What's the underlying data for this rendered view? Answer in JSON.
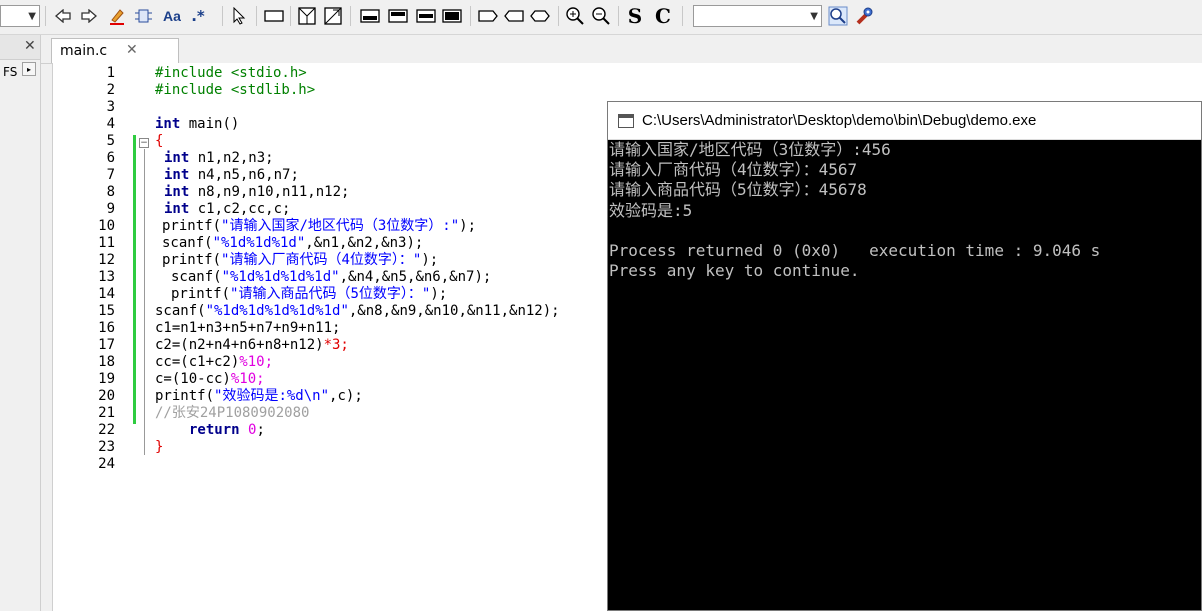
{
  "toolbar": {
    "text_buttons": {
      "font_icon_label": "Aa",
      "regex_label": ".*",
      "s_label": "S",
      "c_label": "C"
    }
  },
  "left_panel": {
    "label": "FS",
    "close_glyph": "✕",
    "arrow_glyph": "▸"
  },
  "tab": {
    "label": "main.c",
    "close_glyph": "✕"
  },
  "line_numbers": [
    "1",
    "2",
    "3",
    "4",
    "5",
    "6",
    "7",
    "8",
    "9",
    "10",
    "11",
    "12",
    "13",
    "14",
    "15",
    "16",
    "17",
    "18",
    "19",
    "20",
    "21",
    "22",
    "23",
    "24"
  ],
  "code": {
    "l1": "#include <stdio.h>",
    "l2": "#include <stdlib.h>",
    "l4_kw": "int",
    "l4_rest": " main()",
    "l5": "{",
    "l6_kw": "int",
    "l6_rest": " n1,n2,n3;",
    "l7_kw": "int",
    "l7_rest": " n4,n5,n6,n7;",
    "l8_kw": "int",
    "l8_rest": " n8,n9,n10,n11,n12;",
    "l9_kw": "int",
    "l9_rest": " c1,c2,cc,c;",
    "l10_fn": "printf(",
    "l10_str": "\"请输入国家/地区代码（3位数字）:\"",
    "l10_end": ");",
    "l11_fn": "scanf(",
    "l11_str": "\"%1d%1d%1d\"",
    "l11_end": ",&n1,&n2,&n3);",
    "l12_fn": "printf(",
    "l12_str": "\"请输入厂商代码（4位数字）：\"",
    "l12_end": ");",
    "l13_fn": "scanf(",
    "l13_str": "\"%1d%1d%1d%1d\"",
    "l13_end": ",&n4,&n5,&n6,&n7);",
    "l14_fn": "printf(",
    "l14_str": "\"请输入商品代码（5位数字）：\"",
    "l14_end": ");",
    "l15_fn": "scanf(",
    "l15_str": "\"%1d%1d%1d%1d%1d\"",
    "l15_end": ",&n8,&n9,&n10,&n11,&n12);",
    "l16": "c1=n1+n3+n5+n7+n9+n11;",
    "l17_a": "c2=(n2+n4+n6+n8+n12)",
    "l17_b": "*3;",
    "l18_a": "cc=(c1+c2)",
    "l18_b": "%10;",
    "l19_a": "c=(10-cc)",
    "l19_b": "%10;",
    "l20_fn": "printf(",
    "l20_str": "\"效验码是:%d\\n\"",
    "l20_end": ",c);",
    "l21": "//张安24P1080902080",
    "l22_kw": "return",
    "l22_num": " 0",
    "l22_end": ";",
    "l23": "}"
  },
  "console": {
    "title": "C:\\Users\\Administrator\\Desktop\\demo\\bin\\Debug\\demo.exe",
    "lines": [
      "请输入国家/地区代码（3位数字）:456",
      "请输入厂商代码（4位数字）：4567",
      "请输入商品代码（5位数字）：45678",
      "效验码是:5",
      "",
      "Process returned 0 (0x0)   execution time : 9.046 s",
      "Press any key to continue."
    ]
  }
}
